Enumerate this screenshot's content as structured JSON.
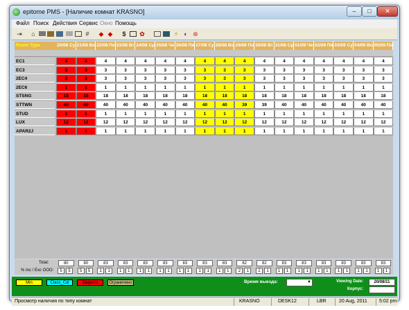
{
  "window": {
    "title": "epitome PMS - [Наличие комнат KRASNO]",
    "min": "–",
    "max": "□",
    "close": "✕"
  },
  "menu": [
    "Файл",
    "Поиск",
    "Действия",
    "Сервис",
    "Окно",
    "Помощь"
  ],
  "toolbar_icons": [
    "exit-icon",
    "bank-icon",
    "grid-icon",
    "books-icon",
    "screen-icon",
    "tiles-icon",
    "table-icon",
    "chart-icon",
    "left-arrow-icon",
    "right-arrow-icon",
    "dollar-icon",
    "calc-icon",
    "flower-icon",
    "panel-icon",
    "monitor-icon",
    "flash-icon",
    "power-icon",
    "plus-icon"
  ],
  "grid": {
    "room_type_label": "Room Type",
    "dates": [
      "20/08 Су",
      "21/08 Во",
      "22/08 По",
      "23/08 Вт",
      "24/08 Ср",
      "25/08 Че",
      "26/08 Пя",
      "27/08 Су",
      "28/08 Во",
      "29/08 По",
      "30/08 Вт",
      "31/08 Ср",
      "01/09 Че",
      "02/09 Пя",
      "03/09 Су",
      "04/09 Во",
      "05/09 По"
    ],
    "rows": [
      {
        "type": "EC1",
        "values": [
          "4",
          "4",
          "4",
          "4",
          "4",
          "4",
          "4",
          "4",
          "4",
          "4",
          "4",
          "4",
          "4",
          "4",
          "4",
          "4",
          "4"
        ]
      },
      {
        "type": "EC3",
        "values": [
          "3",
          "3",
          "3",
          "3",
          "3",
          "3",
          "3",
          "3",
          "3",
          "3",
          "3",
          "3",
          "3",
          "3",
          "3",
          "3",
          "3"
        ]
      },
      {
        "type": "2EC4",
        "values": [
          "3",
          "3",
          "3",
          "3",
          "3",
          "3",
          "3",
          "3",
          "3",
          "3",
          "3",
          "3",
          "3",
          "3",
          "3",
          "3",
          "3"
        ]
      },
      {
        "type": "2EC6",
        "values": [
          "1",
          "1",
          "1",
          "1",
          "1",
          "1",
          "1",
          "1",
          "1",
          "1",
          "1",
          "1",
          "1",
          "1",
          "1",
          "1",
          "1"
        ]
      },
      {
        "type": "STSNG",
        "values": [
          "18",
          "18",
          "18",
          "18",
          "18",
          "18",
          "18",
          "18",
          "18",
          "18",
          "18",
          "18",
          "18",
          "18",
          "18",
          "18",
          "18"
        ]
      },
      {
        "type": "STTWN",
        "values": [
          "40",
          "40",
          "40",
          "40",
          "40",
          "40",
          "40",
          "40",
          "40",
          "39",
          "39",
          "40",
          "40",
          "40",
          "40",
          "40",
          "40"
        ]
      },
      {
        "type": "STUD",
        "values": [
          "1",
          "1",
          "1",
          "1",
          "1",
          "1",
          "1",
          "1",
          "1",
          "1",
          "1",
          "1",
          "1",
          "1",
          "1",
          "1",
          "1"
        ]
      },
      {
        "type": "LUX",
        "values": [
          "12",
          "12",
          "12",
          "12",
          "12",
          "12",
          "12",
          "12",
          "12",
          "12",
          "12",
          "12",
          "12",
          "12",
          "12",
          "12",
          "12"
        ]
      },
      {
        "type": "APAR2J",
        "values": [
          "1",
          "1",
          "1",
          "1",
          "1",
          "1",
          "1",
          "1",
          "1",
          "1",
          "1",
          "1",
          "1",
          "1",
          "1",
          "1",
          "1"
        ]
      }
    ],
    "column_colors": [
      "#ff0000",
      "#ff0000",
      "#ffffff",
      "#ffffff",
      "#ffffff",
      "#ffffff",
      "#ffffff",
      "#ffff00",
      "#ffff00",
      "#ffff00",
      "#ffffff",
      "#ffffff",
      "#ffffff",
      "#ffffff",
      "#ffffff",
      "#ffffff",
      "#ffffff"
    ],
    "total_label": "Total:",
    "totals": [
      "80",
      "80",
      "83",
      "83",
      "83",
      "83",
      "83",
      "83",
      "83",
      "82",
      "82",
      "83",
      "83",
      "83",
      "83",
      "83",
      "83"
    ],
    "inc_label": "% Inc / Exc OOO:",
    "inc_exc": [
      [
        "5",
        "5"
      ],
      [
        "5",
        "5"
      ],
      [
        "1",
        "1"
      ],
      [
        "1",
        "1"
      ],
      [
        "1",
        "1"
      ],
      [
        "1",
        "1"
      ],
      [
        "1",
        "1"
      ],
      [
        "1",
        "1"
      ],
      [
        "1",
        "1"
      ],
      [
        "2",
        "1"
      ],
      [
        "2",
        "1"
      ],
      [
        "1",
        "1"
      ],
      [
        "1",
        "1"
      ],
      [
        "1",
        "1"
      ],
      [
        "1",
        "1"
      ],
      [
        "1",
        "1"
      ],
      [
        "1",
        "1"
      ]
    ]
  },
  "legend": [
    {
      "label": "Min",
      "color": "#ffff00"
    },
    {
      "label": "Class_Cxl",
      "color": "#00ffff"
    },
    {
      "label": "Закрыто",
      "color": "#ff0000"
    },
    {
      "label": "Ограничено",
      "color": "#c0c080"
    }
  ],
  "footer": {
    "time_label": "Время выезда:",
    "time_value": "",
    "viewing_label": "Viewing Date:",
    "viewing_value": "20/08/11",
    "corp_label": "Корпус:",
    "corp_value": ""
  },
  "status": {
    "text": "Просмотр наличия по типу комнат",
    "hotel": "KRASNO",
    "desk": "DESK12",
    "user": "LBR",
    "date": "20 Aug, 2011",
    "time": "5:02 pm"
  }
}
